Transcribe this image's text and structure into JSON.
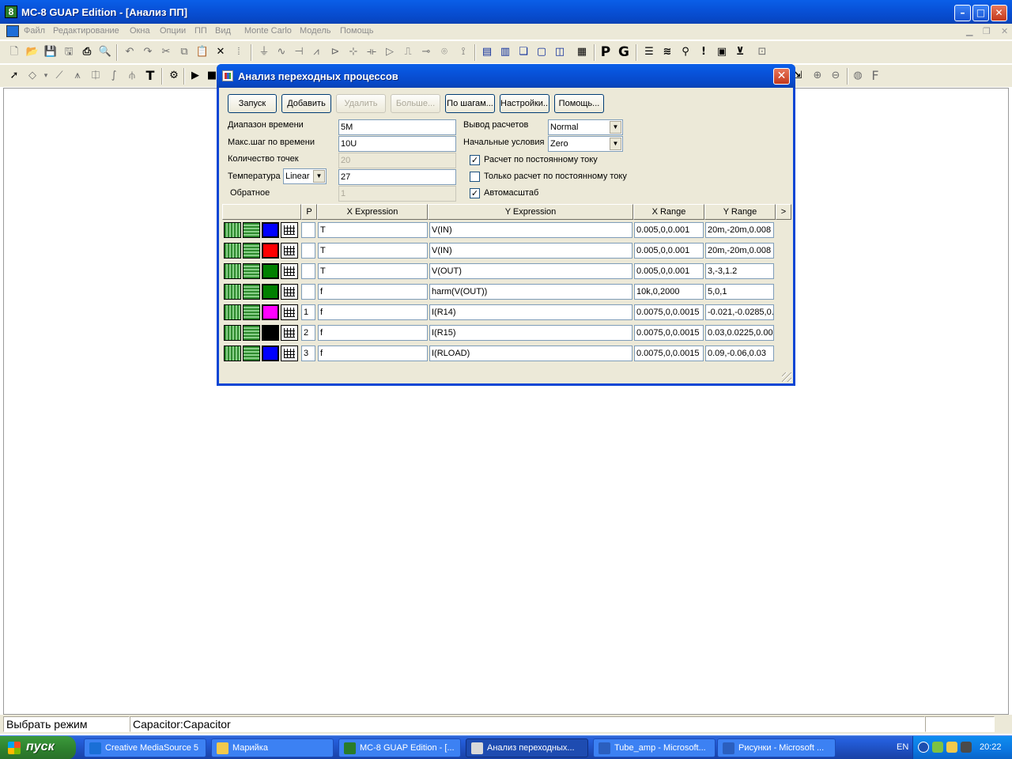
{
  "window": {
    "title": "MC-8 GUAP Edition - [Анализ ПП]",
    "app_icon_glyph": "8"
  },
  "menu": {
    "items": [
      "Файл",
      "Редактирование",
      "Окна",
      "Опции",
      "ПП",
      "Вид",
      "Monte Carlo",
      "Модель",
      "Помощь"
    ]
  },
  "toolbar": {
    "letter_p": "P",
    "letter_g": "G",
    "letter_t": "T",
    "letter_f": "F"
  },
  "dialog": {
    "title": "Анализ переходных процессов",
    "buttons": [
      {
        "label": "Запуск",
        "disabled": false
      },
      {
        "label": "Добавить",
        "disabled": false
      },
      {
        "label": "Удалить",
        "disabled": true
      },
      {
        "label": "Больше...",
        "disabled": true
      },
      {
        "label": "По шагам...",
        "disabled": false
      },
      {
        "label": "Настройки...",
        "disabled": false
      },
      {
        "label": "Помощь...",
        "disabled": false
      }
    ],
    "fields": {
      "time_range": {
        "label": "Диапазон времени",
        "value": "5M"
      },
      "max_step": {
        "label": "Макс.шаг по времени",
        "value": "10U"
      },
      "num_points": {
        "label": "Количество точек",
        "value": "20"
      },
      "temperature": {
        "label": "Температура",
        "mode": "Linear",
        "value": "27"
      },
      "reverse": {
        "label": "Обратное",
        "value": "1"
      }
    },
    "output": {
      "label": "Вывод расчетов",
      "value": "Normal"
    },
    "initial": {
      "label": "Начальные условия",
      "value": "Zero"
    },
    "checkboxes": [
      {
        "label": "Расчет по постоянному току",
        "checked": true
      },
      {
        "label": "Только расчет по постоянному току",
        "checked": false
      },
      {
        "label": "Автомасштаб",
        "checked": true
      }
    ],
    "grid": {
      "headers": {
        "p": "P",
        "x": "X Expression",
        "y": "Y Expression",
        "xr": "X Range",
        "yr": "Y Range",
        "more": ">"
      },
      "rows": [
        {
          "color": "#0000ff",
          "p": "",
          "x": "T",
          "y": "V(IN)",
          "xr": "0.005,0,0.001",
          "yr": "20m,-20m,0.008"
        },
        {
          "color": "#ff0000",
          "p": "",
          "x": "T",
          "y": "V(IN)",
          "xr": "0.005,0,0.001",
          "yr": "20m,-20m,0.008"
        },
        {
          "color": "#008000",
          "p": "",
          "x": "T",
          "y": "V(OUT)",
          "xr": "0.005,0,0.001",
          "yr": "3,-3,1.2"
        },
        {
          "color": "#008000",
          "p": "",
          "x": "f",
          "y": "harm(V(OUT))",
          "xr": "10k,0,2000",
          "yr": "5,0,1"
        },
        {
          "color": "#ff00ff",
          "p": "1",
          "x": "f",
          "y": "I(R14)",
          "xr": "0.0075,0,0.0015",
          "yr": "-0.021,-0.0285,0."
        },
        {
          "color": "#000000",
          "p": "2",
          "x": "f",
          "y": "I(R15)",
          "xr": "0.0075,0,0.0015",
          "yr": "0.03,0.0225,0.00"
        },
        {
          "color": "#0000ff",
          "p": "3",
          "x": "f",
          "y": "I(RLOAD)",
          "xr": "0.0075,0,0.0015",
          "yr": "0.09,-0.06,0.03"
        }
      ]
    }
  },
  "status": {
    "mode": "Выбрать режим",
    "component": "Capacitor:Capacitor"
  },
  "taskbar": {
    "start": "пуск",
    "tasks": [
      {
        "label": "Creative MediaSource 5",
        "icon_color": "#1a6fd6",
        "active": false
      },
      {
        "label": "Марийка",
        "icon_color": "#f2c94c",
        "active": false
      },
      {
        "label": "MC-8 GUAP Edition - [...",
        "icon_color": "#2a7c2a",
        "active": false
      },
      {
        "label": "Анализ переходных...",
        "icon_color": "#d9d9d9",
        "active": true
      },
      {
        "label": "Tube_amp - Microsoft...",
        "icon_color": "#2b5fbf",
        "active": false
      },
      {
        "label": "Рисунки - Microsoft ...",
        "icon_color": "#2b5fbf",
        "active": false
      }
    ],
    "lang": "EN",
    "clock": "20:22"
  }
}
